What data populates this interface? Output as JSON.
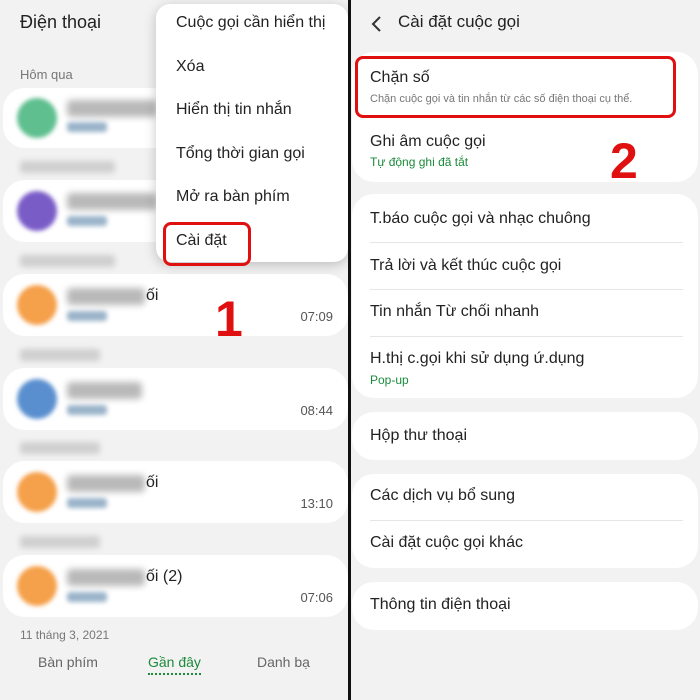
{
  "left": {
    "app_title": "Điện thoại",
    "section_yesterday": "Hôm qua",
    "calls": [
      {
        "name_suffix": "",
        "time": ""
      },
      {
        "name_suffix": "",
        "time": ""
      },
      {
        "name_suffix": "ối",
        "time": "07:09"
      },
      {
        "name_suffix": "",
        "time": "08:44"
      },
      {
        "name_suffix": "ối",
        "time": "13:10"
      },
      {
        "name_suffix": "ối (2)",
        "time": "07:06"
      }
    ],
    "section_date": "11 tháng 3, 2021",
    "menu": {
      "items": [
        "Cuộc gọi cần hiển thị",
        "Xóa",
        "Hiển thị tin nhắn",
        "Tổng thời gian gọi",
        "Mở ra bàn phím",
        "Cài đặt"
      ]
    },
    "step_label": "1",
    "nav": {
      "keypad": "Bàn phím",
      "recents": "Gần đây",
      "contacts": "Danh bạ"
    }
  },
  "right": {
    "title": "Cài đặt cuộc gọi",
    "block_numbers": {
      "label": "Chặn số",
      "sub": "Chặn cuộc gọi và tin nhắn từ các số điện thoại cụ thể."
    },
    "record_calls": {
      "label": "Ghi âm cuộc gọi",
      "sub": "Tự động ghi đã tắt"
    },
    "step_label": "2",
    "items_group2": [
      "T.báo cuộc gọi và nhạc chuông",
      "Trả lời và kết thúc cuộc gọi",
      "Tin nhắn Từ chối nhanh"
    ],
    "show_calls": {
      "label": "H.thị c.gọi khi sử dụng ứ.dụng",
      "sub": "Pop-up"
    },
    "voicemail": "Hộp thư thoại",
    "supplementary": "Các dịch vụ bổ sung",
    "other_settings": "Cài đặt cuộc gọi khác",
    "about": "Thông tin điện thoại"
  },
  "colors": {
    "highlight": "#e01010",
    "accent_green": "#1b8a3a",
    "avatar_colors": [
      "#5fbf8f",
      "#7a5cc7",
      "#f5a04a",
      "#5a8fcf",
      "#f5a04a",
      "#f5a04a"
    ]
  }
}
